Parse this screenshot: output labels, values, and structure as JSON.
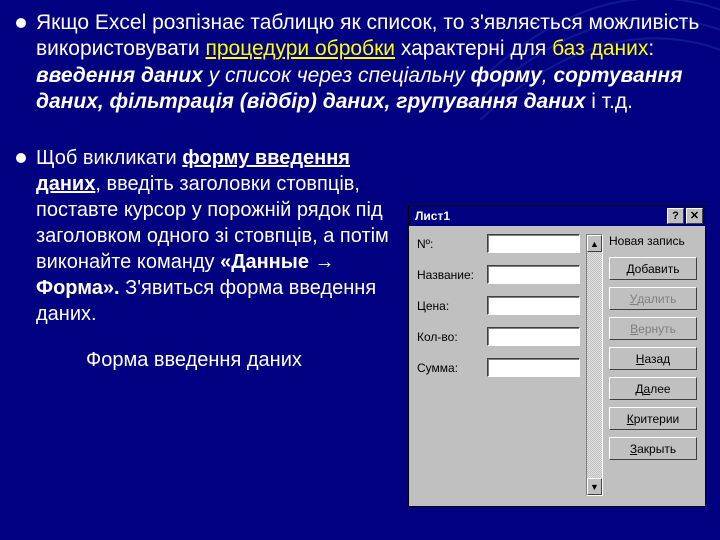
{
  "para1": {
    "lead": "Якщо Excel розпізнає таблицю як список, то з'являється можливість використовувати ",
    "link": "процедури обробки",
    "mid1": " характерні для ",
    "db": "баз даних",
    "mid2": ": ",
    "b1": "введення даних",
    "mid3": " у список через спеціальну ",
    "b2": "форму",
    "mid4": ",  ",
    "b3": "сортування даних,  фільтрація (відбір) даних, групування даних",
    "tail": " і т.д."
  },
  "para2": {
    "lead": "Щоб викликати ",
    "keyword": "форму введення даних",
    "body": ", введіть заголовки стовпців, поставте курсор у порожній рядок під заголовком одного зі стовпців, а потім виконайте команду ",
    "cmd1": "«Данные ",
    "arrow": "→",
    "cmd2": " Форма».",
    "tail": " З'явиться форма введення даних."
  },
  "caption": "Форма введення даних",
  "dialog": {
    "title": "Лист1",
    "helpGlyph": "?",
    "closeGlyph": "✕",
    "fields": [
      {
        "label_pre": "N",
        "label_ul": "",
        "label_post": "º:"
      },
      {
        "label_pre": "Н",
        "label_ul": "",
        "label_post": "азвание:"
      },
      {
        "label_pre": "",
        "label_ul": "",
        "label_post": "Цена:"
      },
      {
        "label_pre": "",
        "label_ul": "",
        "label_post": "Кол-во:"
      },
      {
        "label_pre": "",
        "label_ul": "",
        "label_post": "Сумма:"
      }
    ],
    "scroll": {
      "up": "▲",
      "down": "▼"
    },
    "recordLabel": "Новая запись",
    "buttons": [
      {
        "pre": "",
        "ul": "Д",
        "post": "обавить",
        "disabled": false
      },
      {
        "pre": "",
        "ul": "У",
        "post": "далить",
        "disabled": true
      },
      {
        "pre": "",
        "ul": "В",
        "post": "ернуть",
        "disabled": true
      },
      {
        "pre": "",
        "ul": "Н",
        "post": "азад",
        "disabled": false
      },
      {
        "pre": "Д",
        "ul": "а",
        "post": "лее",
        "disabled": false
      },
      {
        "pre": "",
        "ul": "К",
        "post": "ритерии",
        "disabled": false
      },
      {
        "pre": "",
        "ul": "З",
        "post": "акрыть",
        "disabled": false
      }
    ]
  }
}
